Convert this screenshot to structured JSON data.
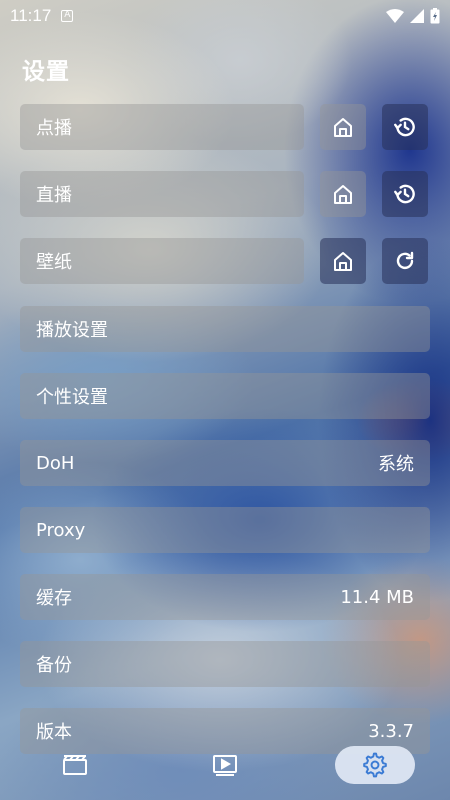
{
  "status_bar": {
    "time": "11:17",
    "notification_icon": "A"
  },
  "page": {
    "title": "设置"
  },
  "rows": {
    "vod": {
      "label": "点播"
    },
    "live": {
      "label": "直播"
    },
    "wallpaper": {
      "label": "壁纸"
    },
    "player_settings": {
      "label": "播放设置"
    },
    "personal_settings": {
      "label": "个性设置"
    },
    "doh": {
      "label": "DoH",
      "value": "系统"
    },
    "proxy": {
      "label": "Proxy"
    },
    "cache": {
      "label": "缓存",
      "value": "11.4 MB"
    },
    "backup": {
      "label": "备份"
    },
    "version": {
      "label": "版本",
      "value": "3.3.7"
    }
  },
  "icons": {
    "home": "home-icon",
    "history": "history-icon",
    "refresh": "refresh-icon",
    "film": "film-icon",
    "play": "play-icon",
    "settings": "gear-icon"
  },
  "colors": {
    "row_bg": "#969696",
    "active_nav_bg": "#e1e8f5",
    "active_nav_icon": "#3b7bd4"
  }
}
